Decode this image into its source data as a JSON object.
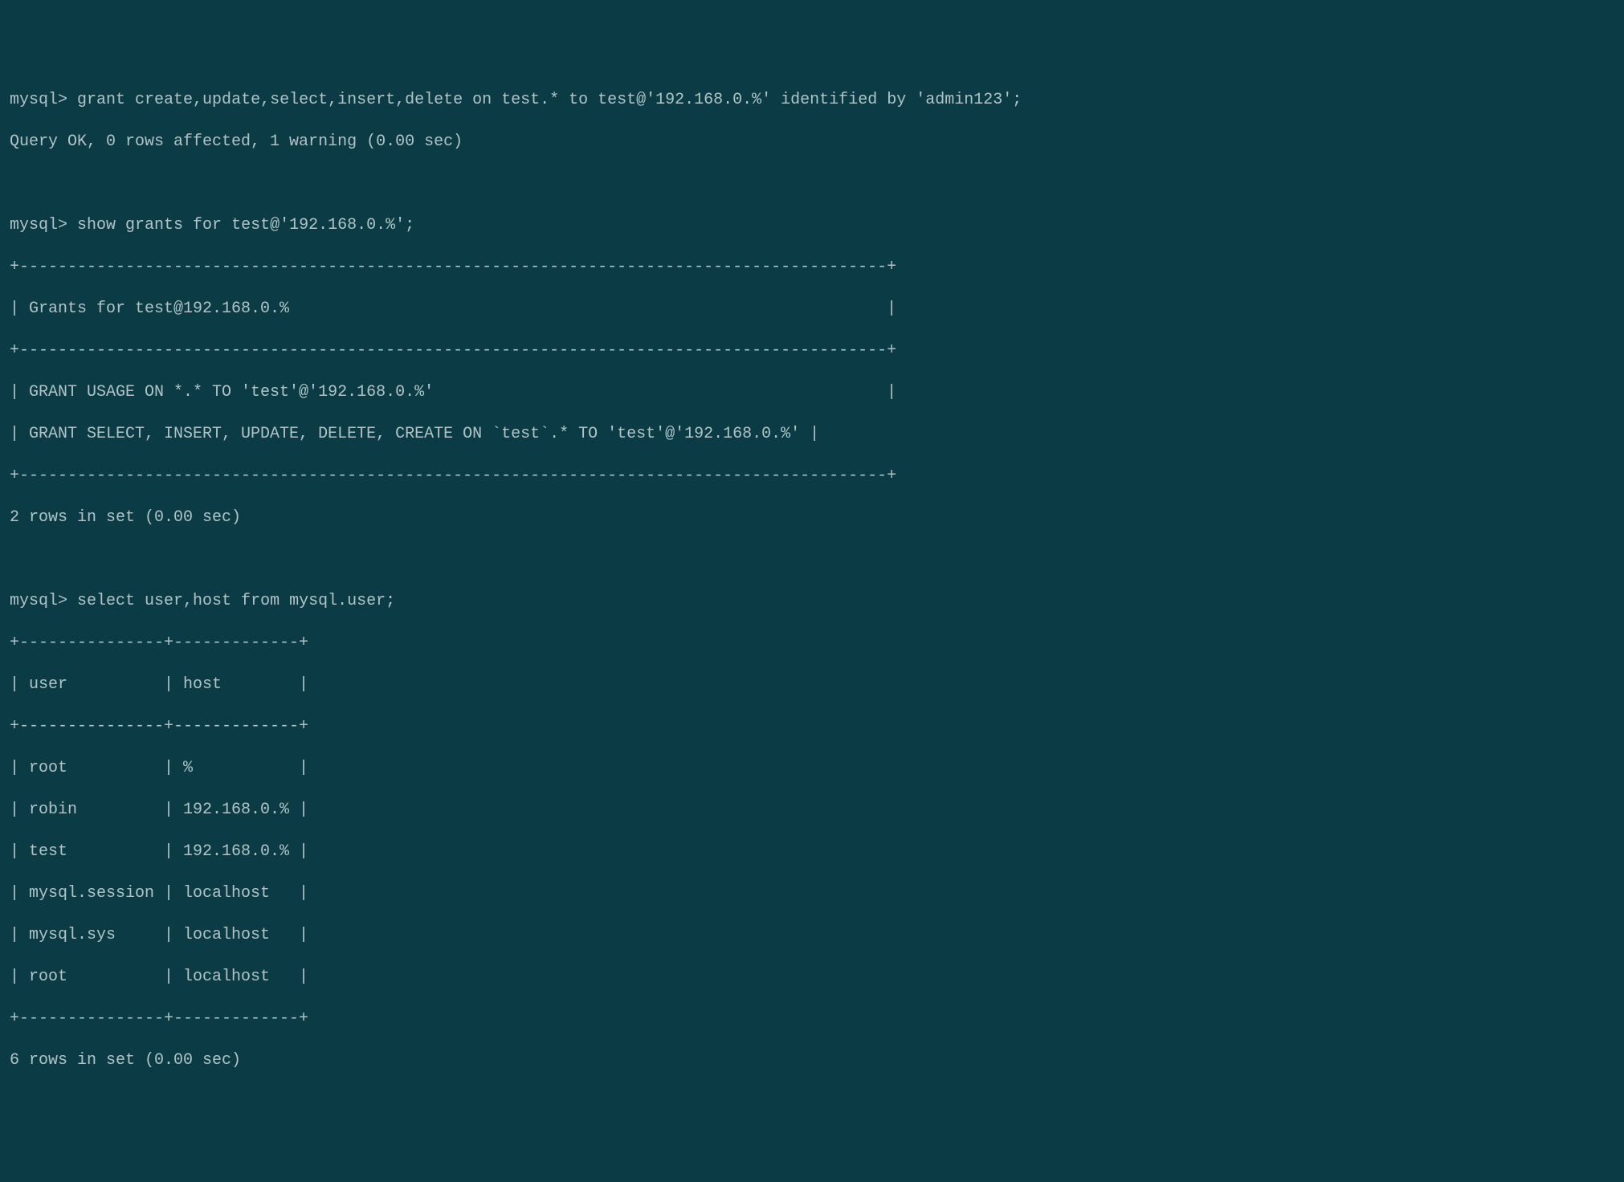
{
  "terminal": {
    "prompt": "mysql>",
    "cmd1": "grant create,update,select,insert,delete on test.* to test@'192.168.0.%' identified by 'admin123';",
    "result1": "Query OK, 0 rows affected, 1 warning (0.00 sec)",
    "cmd2": "show grants for test@'192.168.0.%';",
    "grants_table": {
      "border_top": "+------------------------------------------------------------------------------------------+",
      "header": "| Grants for test@192.168.0.%                                                              |",
      "border_mid": "+------------------------------------------------------------------------------------------+",
      "row1": "| GRANT USAGE ON *.* TO 'test'@'192.168.0.%'                                               |",
      "row2": "| GRANT SELECT, INSERT, UPDATE, DELETE, CREATE ON `test`.* TO 'test'@'192.168.0.%' |",
      "border_bot": "+------------------------------------------------------------------------------------------+"
    },
    "result2": "2 rows in set (0.00 sec)",
    "cmd3": "select user,host from mysql.user;",
    "user_table": {
      "border_top": "+---------------+-------------+",
      "header": "| user          | host        |",
      "border_mid": "+---------------+-------------+",
      "rows": [
        "| root          | %           |",
        "| robin         | 192.168.0.% |",
        "| test          | 192.168.0.% |",
        "| mysql.session | localhost   |",
        "| mysql.sys     | localhost   |",
        "| root          | localhost   |"
      ],
      "border_bot": "+---------------+-------------+"
    },
    "result3": "6 rows in set (0.00 sec)"
  }
}
